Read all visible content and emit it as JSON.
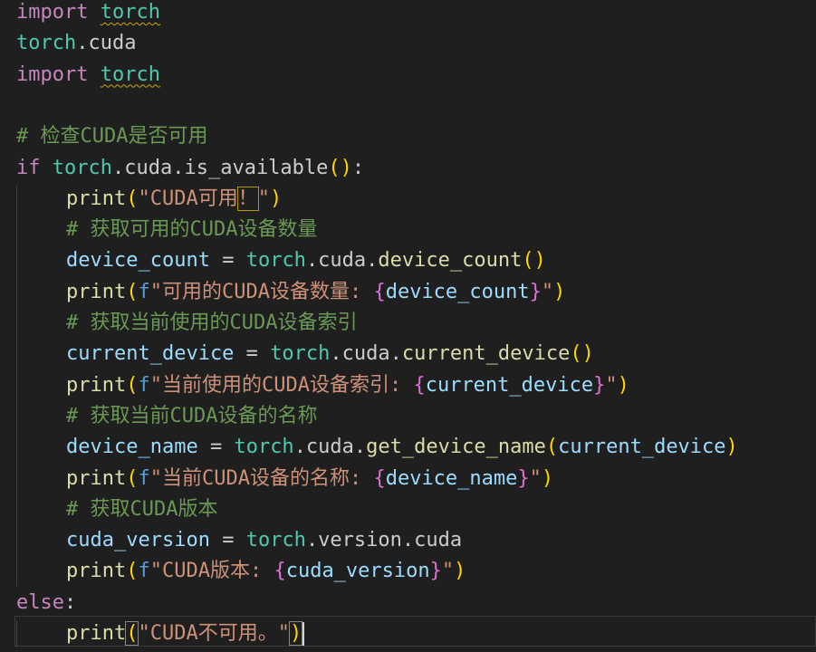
{
  "theme": {
    "background": "#1f1f1f",
    "keyword": "#c586c0",
    "module": "#4ec9b0",
    "variable": "#9cdcfe",
    "function": "#dcdcaa",
    "string": "#ce9178",
    "comment": "#6a9955",
    "plain": "#cccccc",
    "bracket_gold": "#ffd700",
    "bracket_purple": "#da70d6",
    "fstring_prefix": "#569cd6",
    "squiggle": "#cca700"
  },
  "code": [
    {
      "indent": 0,
      "tokens": [
        {
          "t": "import",
          "c": "keyword"
        },
        {
          "t": " ",
          "c": "plain"
        },
        {
          "t": "torch",
          "c": "module",
          "squiggle": true
        }
      ]
    },
    {
      "indent": 0,
      "tokens": [
        {
          "t": "torch",
          "c": "module"
        },
        {
          "t": ".",
          "c": "plain"
        },
        {
          "t": "cuda",
          "c": "plain"
        }
      ]
    },
    {
      "indent": 0,
      "tokens": [
        {
          "t": "import",
          "c": "keyword"
        },
        {
          "t": " ",
          "c": "plain"
        },
        {
          "t": "torch",
          "c": "module",
          "squiggle": true
        }
      ]
    },
    {
      "indent": 0,
      "tokens": []
    },
    {
      "indent": 0,
      "tokens": [
        {
          "t": "# 检查CUDA是否可用",
          "c": "comment"
        }
      ]
    },
    {
      "indent": 0,
      "tokens": [
        {
          "t": "if",
          "c": "keyword"
        },
        {
          "t": " ",
          "c": "plain"
        },
        {
          "t": "torch",
          "c": "module"
        },
        {
          "t": ".cuda.",
          "c": "plain"
        },
        {
          "t": "is_available",
          "c": "plain"
        },
        {
          "t": "()",
          "c": "bracket_gold"
        },
        {
          "t": ":",
          "c": "plain"
        }
      ]
    },
    {
      "indent": 1,
      "tokens": [
        {
          "t": "print",
          "c": "function"
        },
        {
          "t": "(",
          "c": "bracket_gold"
        },
        {
          "t": "\"CUDA可用",
          "c": "string"
        },
        {
          "t": "！",
          "c": "string",
          "warn": true
        },
        {
          "t": "\"",
          "c": "string"
        },
        {
          "t": ")",
          "c": "bracket_gold"
        }
      ]
    },
    {
      "indent": 1,
      "tokens": [
        {
          "t": "# 获取可用的CUDA设备数量",
          "c": "comment"
        }
      ]
    },
    {
      "indent": 1,
      "tokens": [
        {
          "t": "device_count",
          "c": "variable"
        },
        {
          "t": " = ",
          "c": "plain"
        },
        {
          "t": "torch",
          "c": "module"
        },
        {
          "t": ".cuda.",
          "c": "plain"
        },
        {
          "t": "device_count",
          "c": "function"
        },
        {
          "t": "()",
          "c": "bracket_gold"
        }
      ]
    },
    {
      "indent": 1,
      "tokens": [
        {
          "t": "print",
          "c": "function"
        },
        {
          "t": "(",
          "c": "bracket_gold"
        },
        {
          "t": "f",
          "c": "fstring_prefix"
        },
        {
          "t": "\"可用的CUDA设备数量: ",
          "c": "string"
        },
        {
          "t": "{",
          "c": "bracket_purple"
        },
        {
          "t": "device_count",
          "c": "variable"
        },
        {
          "t": "}",
          "c": "bracket_purple"
        },
        {
          "t": "\"",
          "c": "string"
        },
        {
          "t": ")",
          "c": "bracket_gold"
        }
      ]
    },
    {
      "indent": 1,
      "tokens": [
        {
          "t": "# 获取当前使用的CUDA设备索引",
          "c": "comment"
        }
      ]
    },
    {
      "indent": 1,
      "tokens": [
        {
          "t": "current_device",
          "c": "variable"
        },
        {
          "t": " = ",
          "c": "plain"
        },
        {
          "t": "torch",
          "c": "module"
        },
        {
          "t": ".cuda.",
          "c": "plain"
        },
        {
          "t": "current_device",
          "c": "function"
        },
        {
          "t": "()",
          "c": "bracket_gold"
        }
      ]
    },
    {
      "indent": 1,
      "tokens": [
        {
          "t": "print",
          "c": "function"
        },
        {
          "t": "(",
          "c": "bracket_gold"
        },
        {
          "t": "f",
          "c": "fstring_prefix"
        },
        {
          "t": "\"当前使用的CUDA设备索引: ",
          "c": "string"
        },
        {
          "t": "{",
          "c": "bracket_purple"
        },
        {
          "t": "current_device",
          "c": "variable"
        },
        {
          "t": "}",
          "c": "bracket_purple"
        },
        {
          "t": "\"",
          "c": "string"
        },
        {
          "t": ")",
          "c": "bracket_gold"
        }
      ]
    },
    {
      "indent": 1,
      "tokens": [
        {
          "t": "# 获取当前CUDA设备的名称",
          "c": "comment"
        }
      ]
    },
    {
      "indent": 1,
      "tokens": [
        {
          "t": "device_name",
          "c": "variable"
        },
        {
          "t": " = ",
          "c": "plain"
        },
        {
          "t": "torch",
          "c": "module"
        },
        {
          "t": ".cuda.",
          "c": "plain"
        },
        {
          "t": "get_device_name",
          "c": "function"
        },
        {
          "t": "(",
          "c": "bracket_gold"
        },
        {
          "t": "current_device",
          "c": "variable"
        },
        {
          "t": ")",
          "c": "bracket_gold"
        }
      ]
    },
    {
      "indent": 1,
      "tokens": [
        {
          "t": "print",
          "c": "function"
        },
        {
          "t": "(",
          "c": "bracket_gold"
        },
        {
          "t": "f",
          "c": "fstring_prefix"
        },
        {
          "t": "\"当前CUDA设备的名称: ",
          "c": "string"
        },
        {
          "t": "{",
          "c": "bracket_purple"
        },
        {
          "t": "device_name",
          "c": "variable"
        },
        {
          "t": "}",
          "c": "bracket_purple"
        },
        {
          "t": "\"",
          "c": "string"
        },
        {
          "t": ")",
          "c": "bracket_gold"
        }
      ]
    },
    {
      "indent": 1,
      "tokens": [
        {
          "t": "# 获取CUDA版本",
          "c": "comment"
        }
      ]
    },
    {
      "indent": 1,
      "tokens": [
        {
          "t": "cuda_version",
          "c": "variable"
        },
        {
          "t": " = ",
          "c": "plain"
        },
        {
          "t": "torch",
          "c": "module"
        },
        {
          "t": ".version.cuda",
          "c": "plain"
        }
      ]
    },
    {
      "indent": 1,
      "tokens": [
        {
          "t": "print",
          "c": "function"
        },
        {
          "t": "(",
          "c": "bracket_gold"
        },
        {
          "t": "f",
          "c": "fstring_prefix"
        },
        {
          "t": "\"CUDA版本: ",
          "c": "string"
        },
        {
          "t": "{",
          "c": "bracket_purple"
        },
        {
          "t": "cuda_version",
          "c": "variable"
        },
        {
          "t": "}",
          "c": "bracket_purple"
        },
        {
          "t": "\"",
          "c": "string"
        },
        {
          "t": ")",
          "c": "bracket_gold"
        }
      ]
    },
    {
      "indent": 0,
      "tokens": [
        {
          "t": "else",
          "c": "keyword"
        },
        {
          "t": ":",
          "c": "plain"
        }
      ]
    },
    {
      "indent": 1,
      "current": true,
      "tokens": [
        {
          "t": "print",
          "c": "function"
        },
        {
          "t": "(",
          "c": "bracket_gold",
          "box": true
        },
        {
          "t": "\"CUDA不可用。\"",
          "c": "string"
        },
        {
          "t": ")",
          "c": "bracket_gold",
          "box": true,
          "cursor": true
        }
      ]
    }
  ]
}
